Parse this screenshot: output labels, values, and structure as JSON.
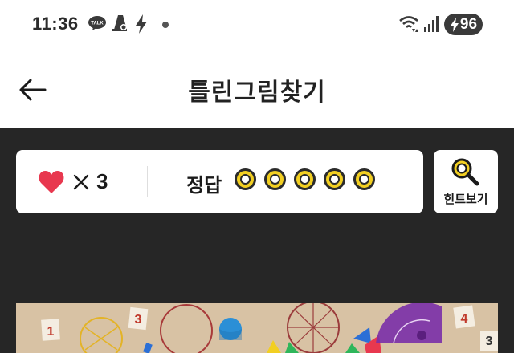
{
  "status_bar": {
    "time": "11:36",
    "talk_badge": "TALK",
    "battery_level": "96"
  },
  "header": {
    "title": "틀린그림찾기"
  },
  "scoreboard": {
    "lives_count": "3",
    "answer_label": "정답",
    "answer_slots_total": 5,
    "answer_slots_found": 0
  },
  "hint": {
    "label": "힌트보기"
  },
  "colors": {
    "heart": "#e8384f",
    "accent_yellow": "#f2cf22",
    "game_background": "#262626"
  },
  "icons": [
    "back-arrow-icon",
    "heart-icon",
    "times-icon",
    "search-icon",
    "wifi-icon",
    "signal-icon",
    "bolt-icon"
  ]
}
